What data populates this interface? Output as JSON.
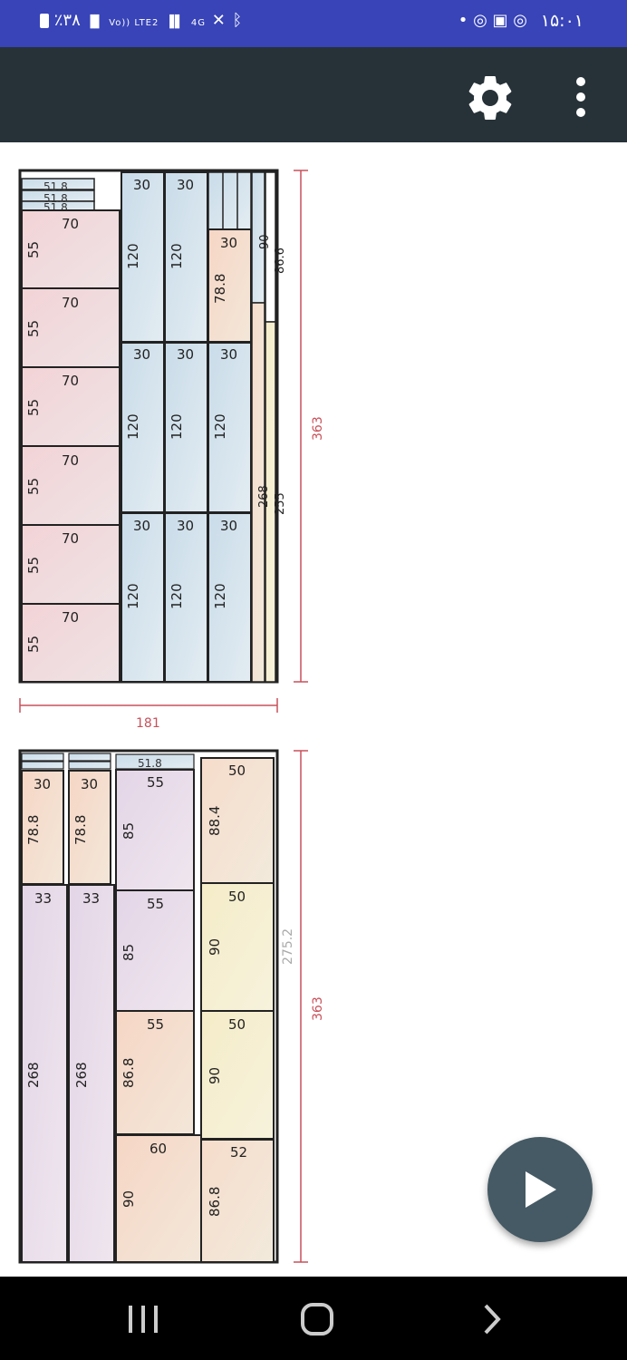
{
  "status_bar": {
    "battery": "٪۳۸",
    "network": "Vo)) LTE2",
    "network_type": "4G",
    "time": "۱۵:۰۱"
  },
  "toolbar": {
    "settings_icon": "gear-icon",
    "menu_icon": "more-vert-icon"
  },
  "sheet_1": {
    "width_label": "181",
    "height_label": "363",
    "pieces": [
      {
        "w": "70",
        "h": "55"
      },
      {
        "w": "70",
        "h": "55"
      },
      {
        "w": "70",
        "h": "55"
      },
      {
        "w": "70",
        "h": "55"
      },
      {
        "w": "70",
        "h": "55"
      },
      {
        "w": "70",
        "h": "55"
      },
      {
        "w": "30",
        "h": "120"
      },
      {
        "w": "30",
        "h": "120"
      },
      {
        "w": "30",
        "h": "120"
      },
      {
        "w": "30",
        "h": "120"
      },
      {
        "w": "30",
        "h": "120"
      },
      {
        "w": "30",
        "h": "120"
      },
      {
        "w": "30",
        "h": "120"
      },
      {
        "w": "30",
        "h": "120"
      },
      {
        "w": "30",
        "h": "78.8"
      }
    ],
    "strips": [
      "51.8",
      "51.8",
      "51.8",
      "90",
      "86.6",
      "268",
      "255"
    ]
  },
  "sheet_2": {
    "height_label": "363",
    "side_label": "275.2",
    "pieces": [
      {
        "w": "30",
        "h": "78.8"
      },
      {
        "w": "30",
        "h": "78.8"
      },
      {
        "w": "33",
        "h": "268"
      },
      {
        "w": "33",
        "h": "268"
      },
      {
        "w": "55",
        "h": "85"
      },
      {
        "w": "55",
        "h": "85"
      },
      {
        "w": "55",
        "h": "86.8"
      },
      {
        "w": "60",
        "h": "90"
      },
      {
        "w": "50",
        "h": "88.4"
      },
      {
        "w": "50",
        "h": "90"
      },
      {
        "w": "50",
        "h": "90"
      },
      {
        "w": "52",
        "h": "86.8"
      }
    ],
    "strips": [
      "51.8"
    ]
  },
  "fab": {
    "icon": "play-icon"
  },
  "nav_bar": {
    "recents": "recents-icon",
    "home": "home-icon",
    "back": "back-icon"
  }
}
